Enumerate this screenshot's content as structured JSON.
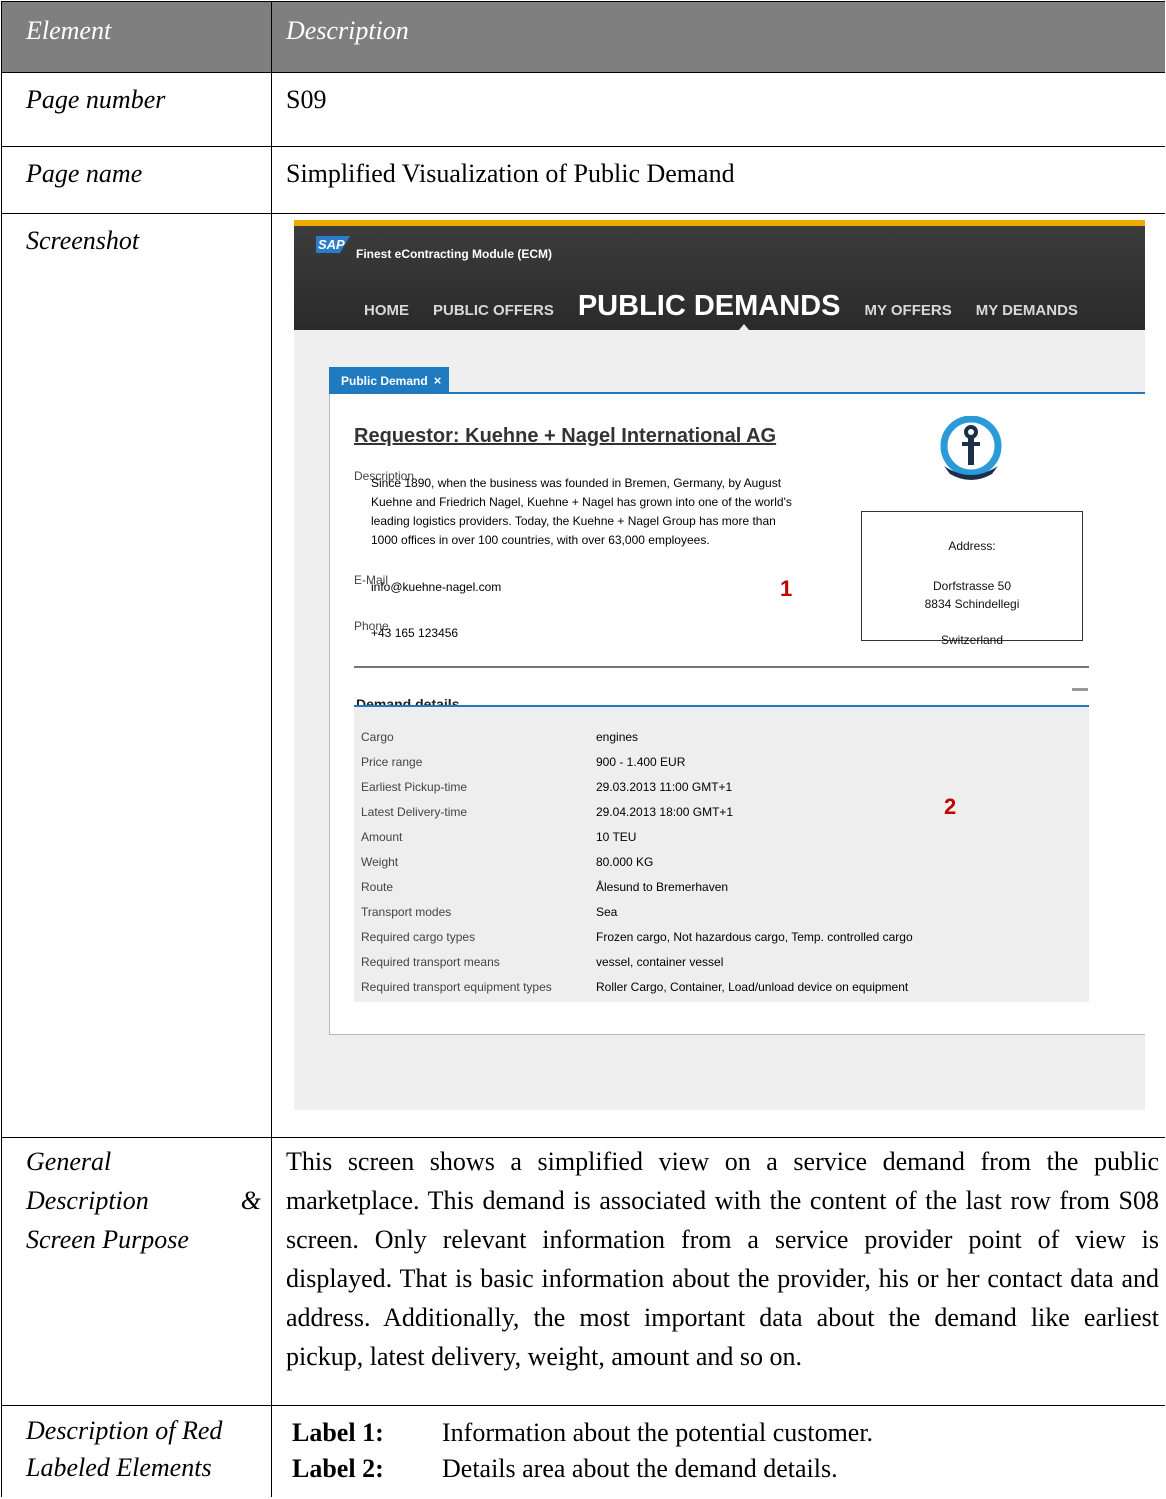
{
  "header": {
    "element": "Element",
    "description": "Description"
  },
  "rows": {
    "page_number": {
      "label": "Page number",
      "value": "S09"
    },
    "page_name": {
      "label": "Page name",
      "value": "Simplified Visualization of Public Demand"
    },
    "screenshot": {
      "label": "Screenshot"
    },
    "general": {
      "label_lines": [
        "General",
        "Description",
        "&",
        "Screen Purpose"
      ],
      "text": "This screen shows a simplified view on a service demand from the public marketplace. This demand is associated with the content of the last row from S08 screen. Only relevant information from a service provider point of view is displayed. That is basic information about the provider, his or her contact data and address. Additionally, the most important data about the demand like earliest pickup, latest delivery, weight, amount and so on."
    },
    "red_labels": {
      "label_lines": [
        "Description of Red",
        "Labeled Elements"
      ],
      "items": [
        {
          "key": "Label 1:",
          "text": "Information about the potential customer."
        },
        {
          "key": "Label 2:",
          "text": "Details area about the demand details."
        }
      ]
    }
  },
  "screenshot": {
    "logo_text": "SAP",
    "app_title": "Finest eContracting Module (ECM)",
    "nav": [
      "HOME",
      "PUBLIC OFFERS",
      "PUBLIC DEMANDS",
      "MY OFFERS",
      "MY DEMANDS"
    ],
    "active_nav": "PUBLIC DEMANDS",
    "tab_label": "Public Demand",
    "tab_close": "×",
    "requestor": "Requestor: Kuehne + Nagel International AG",
    "description_label": "Description",
    "description_lines": [
      "Since 1890, when the business was founded in Bremen, Germany, by August",
      "Kuehne and Friedrich Nagel, Kuehne + Nagel has grown into one of the world's",
      "leading logistics providers. Today, the Kuehne + Nagel Group has more than",
      "1000 offices in over 100 countries, with over 63,000 employees."
    ],
    "email_label": "E-Mail",
    "email": "info@kuehne-nagel.com",
    "phone_label": "Phone",
    "phone": "+43 165 123456",
    "address": {
      "heading": "Address:",
      "street": "Dorfstrasse 50",
      "city": "8834 Schindellegi",
      "country": "Switzerland"
    },
    "marker_1": "1",
    "marker_2": "2",
    "section_title": "Demand details",
    "details": [
      {
        "key": "Cargo",
        "value": "engines"
      },
      {
        "key": "Price range",
        "value": "900 - 1.400 EUR"
      },
      {
        "key": "Earliest Pickup-time",
        "value": "29.03.2013 11:00 GMT+1"
      },
      {
        "key": "Latest Delivery-time",
        "value": "29.04.2013 18:00 GMT+1"
      },
      {
        "key": "Amount",
        "value": "10 TEU"
      },
      {
        "key": "Weight",
        "value": "80.000 KG"
      },
      {
        "key": "Route",
        "value": "Ålesund to Bremerhaven"
      },
      {
        "key": "Transport modes",
        "value": "Sea"
      },
      {
        "key": "Required cargo types",
        "value": "Frozen cargo, Not hazardous cargo, Temp. controlled cargo"
      },
      {
        "key": "Required transport means",
        "value": "vessel, container vessel"
      },
      {
        "key": "Required transport equipment types",
        "value": "Roller Cargo, Container, Load/unload device on equipment"
      }
    ],
    "colors": {
      "brand_orange": "#f0ab00",
      "sap_blue": "#2b7cc9",
      "accent_blue": "#1f7ac0",
      "marker_red": "#c00000",
      "logo_blue": "#2a9bd8",
      "logo_navy": "#1d2e4a"
    }
  }
}
